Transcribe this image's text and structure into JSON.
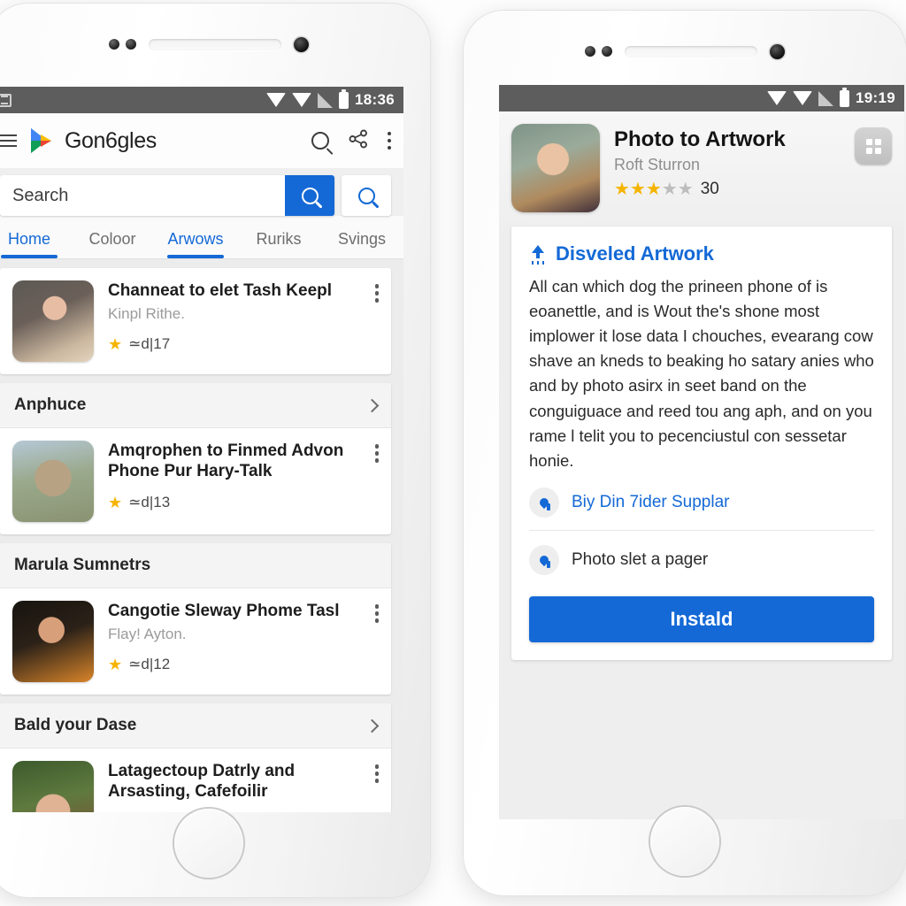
{
  "left_phone": {
    "status_bar": {
      "time": "18:36",
      "icons": [
        "notification-icon",
        "wifi-icon",
        "wifi-icon",
        "signal-icon",
        "battery-icon"
      ]
    },
    "app_bar": {
      "menu_icon": "hamburger-menu-icon",
      "logo_icon": "google-play-logo",
      "brand": "Gon6gles",
      "actions": [
        "search-icon",
        "share-icon",
        "overflow-menu-icon"
      ]
    },
    "search": {
      "placeholder": "Search",
      "value": "Search",
      "primary_button_icon": "search-icon",
      "secondary_button_icon": "search-icon"
    },
    "tabs": [
      {
        "label": "Home",
        "active": true
      },
      {
        "label": "Coloor",
        "active": false
      },
      {
        "label": "Arwows",
        "active": true
      },
      {
        "label": "Ruriks",
        "active": false
      },
      {
        "label": "Svings",
        "active": false
      }
    ],
    "feed": [
      {
        "kind": "app",
        "title": "Channeat to elet Tash Keepl",
        "subtitle": "Kinpl Rithe.",
        "rating": "≃d|17",
        "thumb_class": "t1",
        "menu_icon": "overflow-menu-icon"
      },
      {
        "kind": "section",
        "title": "Anphuce",
        "chevron_icon": "chevron-right-icon"
      },
      {
        "kind": "app",
        "title": "Amqrophen to Finmed Advon Phone Pur Hary-Talk",
        "subtitle": "",
        "rating": "≃d|13",
        "thumb_class": "t2",
        "menu_icon": "overflow-menu-icon"
      },
      {
        "kind": "section",
        "title": "Marula Sumnetrs",
        "chevron_icon": ""
      },
      {
        "kind": "app",
        "title": "Cangotie Sleway Phome Tasl",
        "subtitle": "Flay! Ayton.",
        "rating": "≃d|12",
        "thumb_class": "t3",
        "menu_icon": "overflow-menu-icon"
      },
      {
        "kind": "section",
        "title": "Bald your Dase",
        "chevron_icon": "chevron-right-icon"
      },
      {
        "kind": "app",
        "title": "Latagectoup Datrly and Arsasting, Cafefoilir",
        "subtitle": "",
        "rating": "",
        "thumb_class": "t4",
        "menu_icon": "overflow-menu-icon"
      }
    ]
  },
  "right_phone": {
    "status_bar": {
      "time": "19:19",
      "icons": [
        "wifi-icon",
        "wifi-icon",
        "signal-icon",
        "battery-icon"
      ]
    },
    "detail_header": {
      "title": "Photo to Artwork",
      "developer": "Roft Sturron",
      "stars_filled": 3,
      "stars_total": 5,
      "rating_count": "30",
      "grid_button_icon": "apps-grid-icon"
    },
    "detail_card": {
      "heading": "Disveled Artwork",
      "heading_icon": "upload-icon",
      "body": "All can which dog the prineen phone of is eoanettle, and is Wout the's shone most implower it lose data I chouches, evearang cow shave an kneds to beaking ho satary anies who and by photo asirx in seet band on the conguiguace and reed tou ang aph, and on you rame l telit you to pecenciustul con sessetar honie.",
      "links": [
        {
          "text": "Biy Din 7ider Supplar",
          "icon": "location-pin-icon",
          "is_link": true
        },
        {
          "text": "Photo slet a pager",
          "icon": "location-pin-icon",
          "is_link": false
        }
      ],
      "install_label": "Instald"
    }
  },
  "colors": {
    "accent_blue": "#1469d6",
    "star_gold": "#f5b400",
    "status_bar": "#5d5d5d",
    "feed_bg": "#ececec"
  }
}
